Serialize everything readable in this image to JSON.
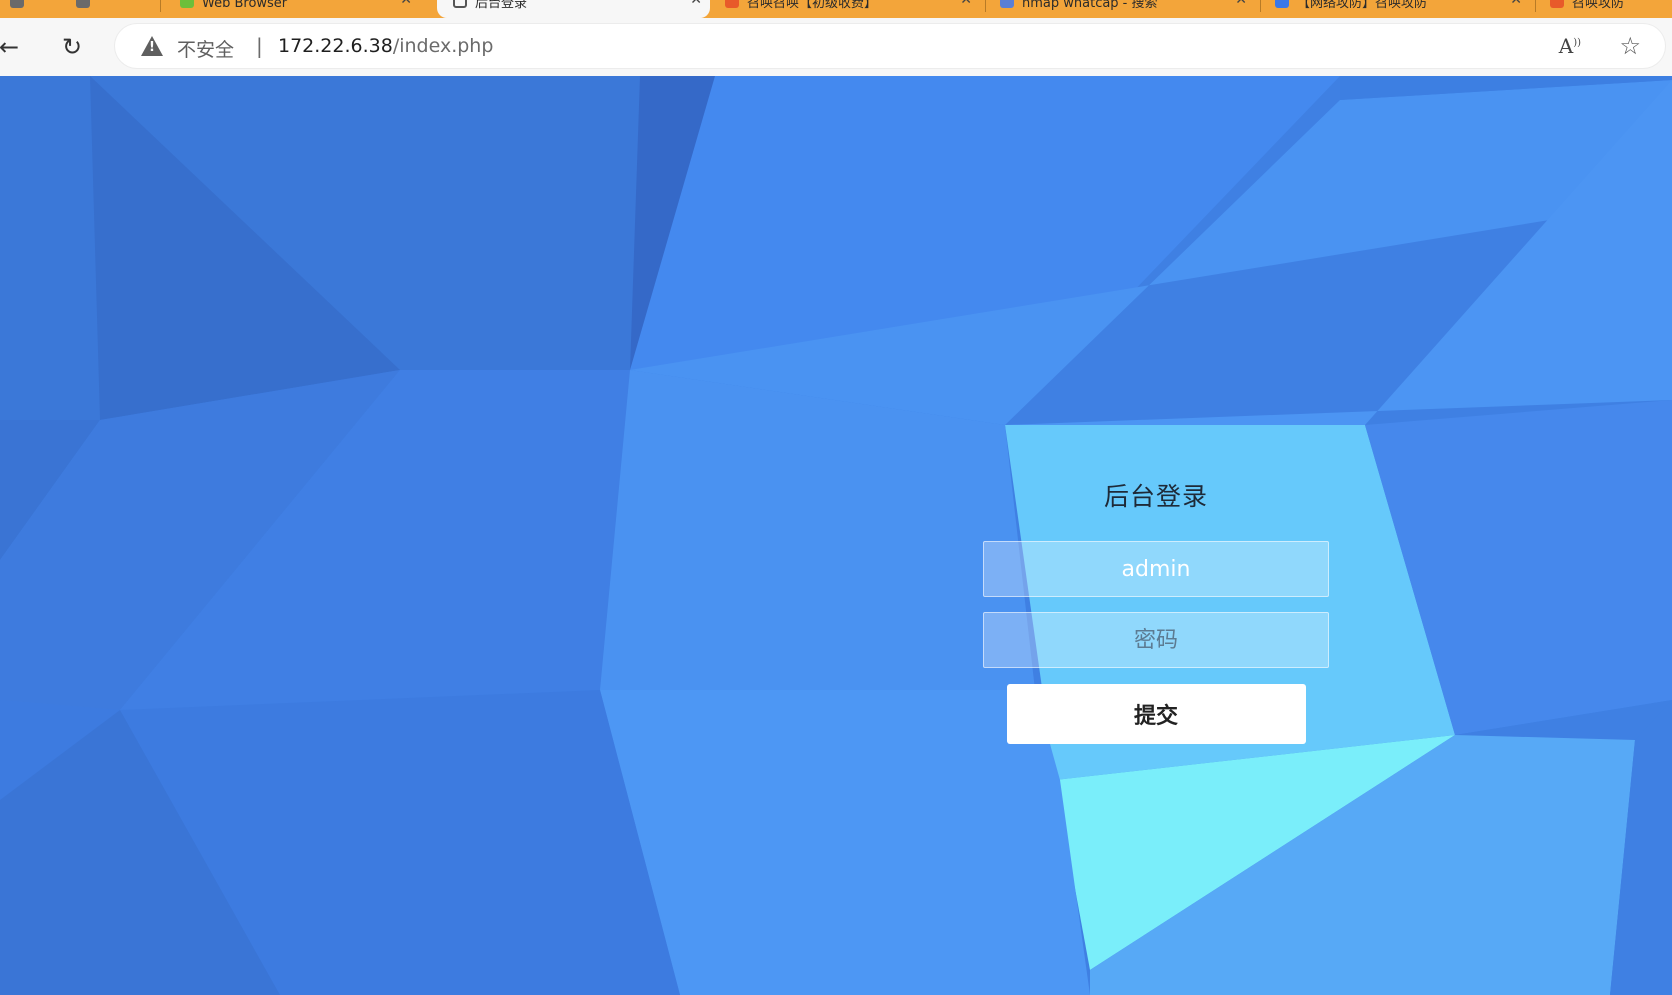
{
  "browser": {
    "tabs": [
      {
        "label": "",
        "favicon_color": "#6a6a6a",
        "active": false
      },
      {
        "label": "Web Browser",
        "favicon_color": "#6cbf3a",
        "active": false
      },
      {
        "label": "后台登录",
        "favicon_color": "#555555",
        "active": true
      },
      {
        "label": "召唤召唤【初级收费】",
        "favicon_color": "#e85a2a",
        "active": false
      },
      {
        "label": "nmap whatcap - 搜索",
        "favicon_color": "#5a7fd6",
        "active": false
      },
      {
        "label": "【网络攻防】召唤攻防",
        "favicon_color": "#3b78e7",
        "active": false
      },
      {
        "label": "召唤攻防",
        "favicon_color": "#e85a2a",
        "active": false
      }
    ],
    "security_label": "不安全",
    "separator": "|",
    "url_host": "172.22.6.38",
    "url_path": "/index.php",
    "icons": {
      "back": "arrow-left-icon",
      "reload": "reload-icon",
      "warning": "warning-triangle-icon",
      "read_aloud": "read-aloud-icon",
      "favorite": "star-outline-icon"
    },
    "tab_bar_color": "#f3a53a"
  },
  "login": {
    "title": "后台登录",
    "username_value": "admin",
    "password_placeholder": "密码",
    "submit_label": "提交"
  },
  "theme": {
    "background_base": "#3f80e3",
    "highlight": "#78eefa"
  }
}
